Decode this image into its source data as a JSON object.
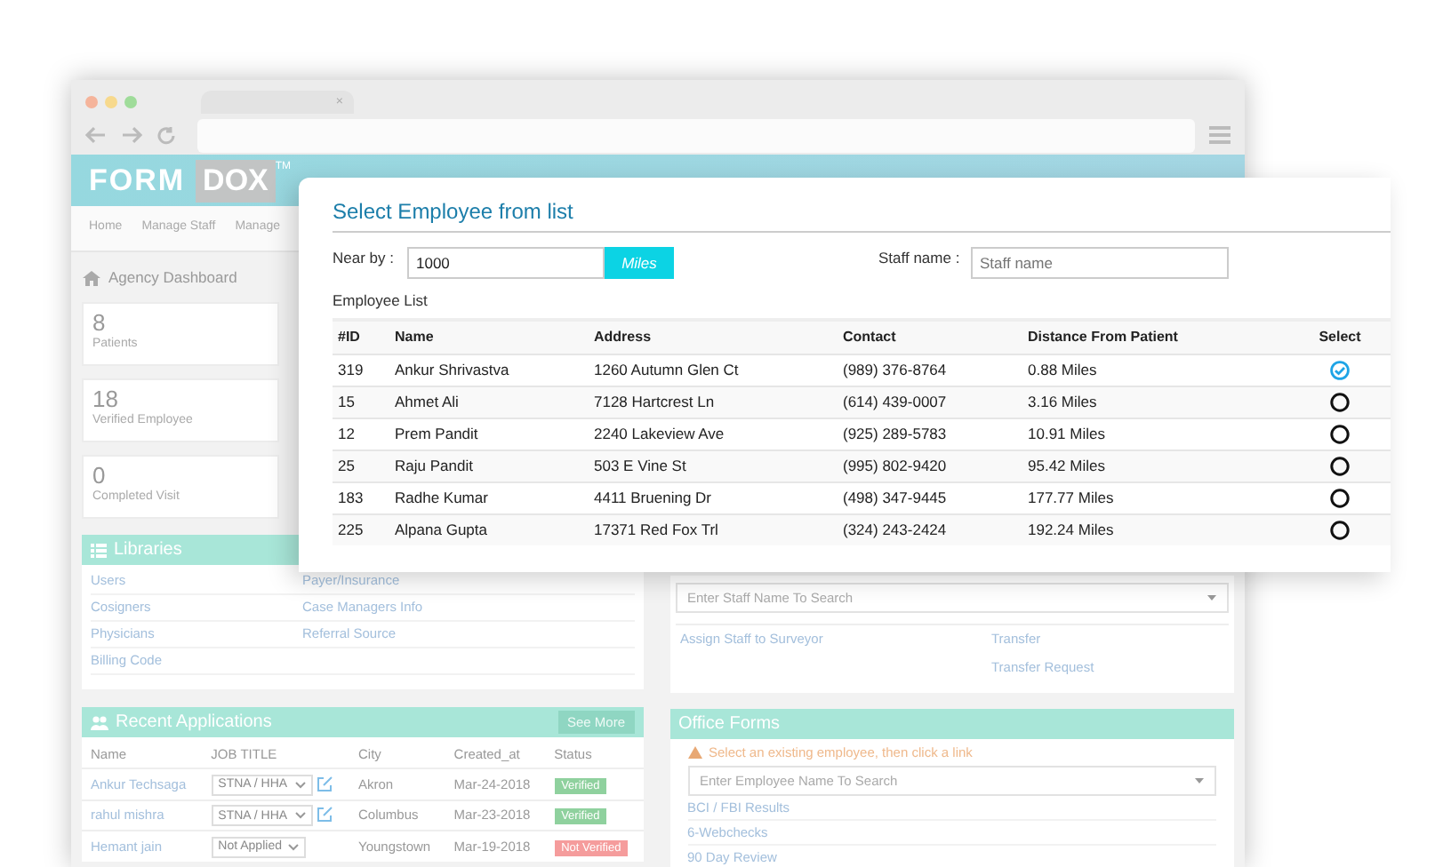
{
  "browser": {
    "tab_close": "×"
  },
  "app": {
    "logo": {
      "part_1": "FORM",
      "part_2": "DOX",
      "mark": "TM"
    },
    "nav": [
      "Home",
      "Manage Staff",
      "Manage"
    ],
    "dashboard_title": "Agency Dashboard",
    "stats": [
      {
        "value": "8",
        "label": "Patients"
      },
      {
        "value": "18",
        "label": "Verified Employee"
      },
      {
        "value": "0",
        "label": "Completed Visit"
      }
    ],
    "libraries": {
      "title": "Libraries",
      "links": [
        "Users",
        "Payer/Insurance",
        "Cosigners",
        "Case Managers Info",
        "Physicians",
        "Referral Source",
        "Billing Code"
      ]
    },
    "recent_applications": {
      "title": "Recent Applications",
      "see_more": "See More",
      "columns": [
        "Name",
        "JOB TITLE",
        "City",
        "Created_at",
        "Status"
      ],
      "rows": [
        {
          "name": "Ankur Techsaga",
          "job_title": "STNA / HHA",
          "editable": true,
          "city": "Akron",
          "created_at": "Mar-24-2018",
          "status": "Verified",
          "kind": "verified"
        },
        {
          "name": "rahul mishra",
          "job_title": "STNA / HHA",
          "editable": true,
          "city": "Columbus",
          "created_at": "Mar-23-2018",
          "status": "Verified",
          "kind": "verified"
        },
        {
          "name": "Hemant jain",
          "job_title": "Not Applied",
          "editable": false,
          "city": "Youngstown",
          "created_at": "Mar-19-2018",
          "status": "Not Verified",
          "kind": "not_verified"
        }
      ]
    },
    "staff_panel": {
      "search_placeholder": "Enter Staff Name To Search",
      "left_links": [
        "Assign Staff to Surveyor"
      ],
      "right_links": [
        "Transfer",
        "Transfer Request"
      ]
    },
    "office_forms": {
      "title": "Office Forms",
      "warning": "Select an existing employee, then click a link",
      "search_placeholder": "Enter Employee Name To Search",
      "links": [
        "BCI / FBI Results",
        "6-Webchecks",
        "90 Day Review"
      ]
    }
  },
  "modal": {
    "title": "Select Employee from list",
    "near_by_label": "Near by :",
    "near_by_value": "1000",
    "unit_button": "Miles",
    "staff_label": "Staff name :",
    "staff_placeholder": "Staff name",
    "list_title": "Employee List",
    "columns": [
      "#ID",
      "Name",
      "Address",
      "Contact",
      "Distance From Patient",
      "Select"
    ],
    "rows": [
      {
        "id": "319",
        "name": "Ankur Shrivastva",
        "address": "1260 Autumn Glen Ct",
        "contact": "(989) 376-8764",
        "distance": "0.88 Miles",
        "selected": true
      },
      {
        "id": "15",
        "name": "Ahmet Ali",
        "address": "7128 Hartcrest Ln",
        "contact": "(614) 439-0007",
        "distance": "3.16 Miles",
        "selected": false
      },
      {
        "id": "12",
        "name": "Prem Pandit",
        "address": "2240 Lakeview Ave",
        "contact": "(925) 289-5783",
        "distance": "10.91 Miles",
        "selected": false
      },
      {
        "id": "25",
        "name": "Raju Pandit",
        "address": "503 E Vine St",
        "contact": "(995) 802-9420",
        "distance": "95.42 Miles",
        "selected": false
      },
      {
        "id": "183",
        "name": "Radhe Kumar",
        "address": "4411 Bruening Dr",
        "contact": "(498) 347-9445",
        "distance": "177.77 Miles",
        "selected": false
      },
      {
        "id": "225",
        "name": "Alpana Gupta",
        "address": "17371 Red Fox Trl",
        "contact": "(324) 243-2424",
        "distance": "192.24 Miles",
        "selected": false
      }
    ]
  }
}
